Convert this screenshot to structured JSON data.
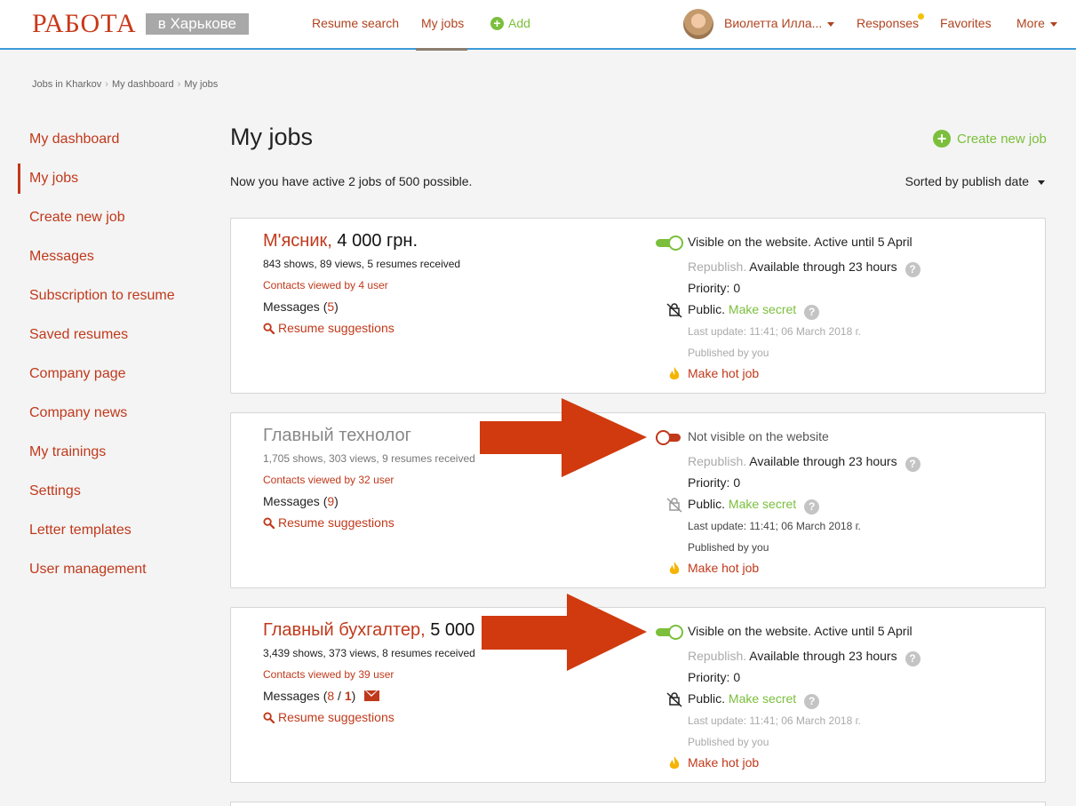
{
  "header": {
    "logo_main": "РАБОТА",
    "logo_city": "в Харькове",
    "nav": {
      "resume_search": "Resume search",
      "my_jobs": "My jobs",
      "add": "Add"
    },
    "user_name": "Виолетта Илла...",
    "responses": "Responses",
    "favorites": "Favorites",
    "more": "More"
  },
  "breadcrumb": [
    "Jobs in Kharkov",
    "My dashboard",
    "My jobs"
  ],
  "sidebar": {
    "items": [
      {
        "label": "My dashboard"
      },
      {
        "label": "My jobs"
      },
      {
        "label": "Create new job"
      },
      {
        "label": "Messages"
      },
      {
        "label": "Subscription to resume"
      },
      {
        "label": "Saved resumes"
      },
      {
        "label": "Company page"
      },
      {
        "label": "Company news"
      },
      {
        "label": "My trainings"
      },
      {
        "label": "Settings"
      },
      {
        "label": "Letter templates"
      },
      {
        "label": "User management"
      }
    ]
  },
  "main": {
    "title": "My jobs",
    "create_label": "Create new job",
    "summary": "Now you have active 2 jobs of 500 possible.",
    "sort_label": "Sorted by publish date"
  },
  "jobs": [
    {
      "title": "М'ясник,",
      "salary": "4 000 грн.",
      "stats": "843 shows, 89 views, 5 resumes received",
      "contacts": "Contacts viewed by 4 user",
      "messages_label": "Messages (",
      "messages_count": "5",
      "messages_new": "",
      "messages_close": ")",
      "suggestions": "Resume suggestions",
      "visibility": "Visible on the website. Active until 5 April",
      "republish": "Republish.",
      "available": "Available through 23 hours",
      "priority": "Priority: 0",
      "public": "Public.",
      "make_secret": "Make secret",
      "last_update": "Last update: 11:41; 06 March 2018 г.",
      "published_by": "Published by you",
      "make_hot": "Make hot job"
    },
    {
      "title": "Главный технолог",
      "salary": "",
      "stats": "1,705 shows, 303 views, 9 resumes received",
      "contacts": "Contacts viewed by 32 user",
      "messages_label": "Messages (",
      "messages_count": "9",
      "messages_new": "",
      "messages_close": ")",
      "suggestions": "Resume suggestions",
      "visibility": "Not visible on the website",
      "republish": "Republish.",
      "available": "Available through 23 hours",
      "priority": "Priority: 0",
      "public": "Public.",
      "make_secret": "Make secret",
      "last_update": "Last update: 11:41; 06 March 2018 г.",
      "published_by": "Published by you",
      "make_hot": "Make hot job"
    },
    {
      "title": "Главный бухгалтер,",
      "salary": "5 000",
      "stats": "3,439 shows, 373 views, 8 resumes received",
      "contacts": "Contacts viewed by 39 user",
      "messages_label": "Messages (",
      "messages_count": "8",
      "messages_sep": " / ",
      "messages_new": "1",
      "messages_close": ")",
      "suggestions": "Resume suggestions",
      "visibility": "Visible on the website. Active until 5 April",
      "republish": "Republish.",
      "available": "Available through 23 hours",
      "priority": "Priority: 0",
      "public": "Public.",
      "make_secret": "Make secret",
      "last_update": "Last update: 11:41; 06 March 2018 г.",
      "published_by": "Published by you",
      "make_hot": "Make hot job"
    }
  ],
  "colors": {
    "brand": "#c0391b",
    "accent_green": "#7bbf3c",
    "header_line": "#3b9ad9",
    "arrow": "#d03a0e"
  }
}
